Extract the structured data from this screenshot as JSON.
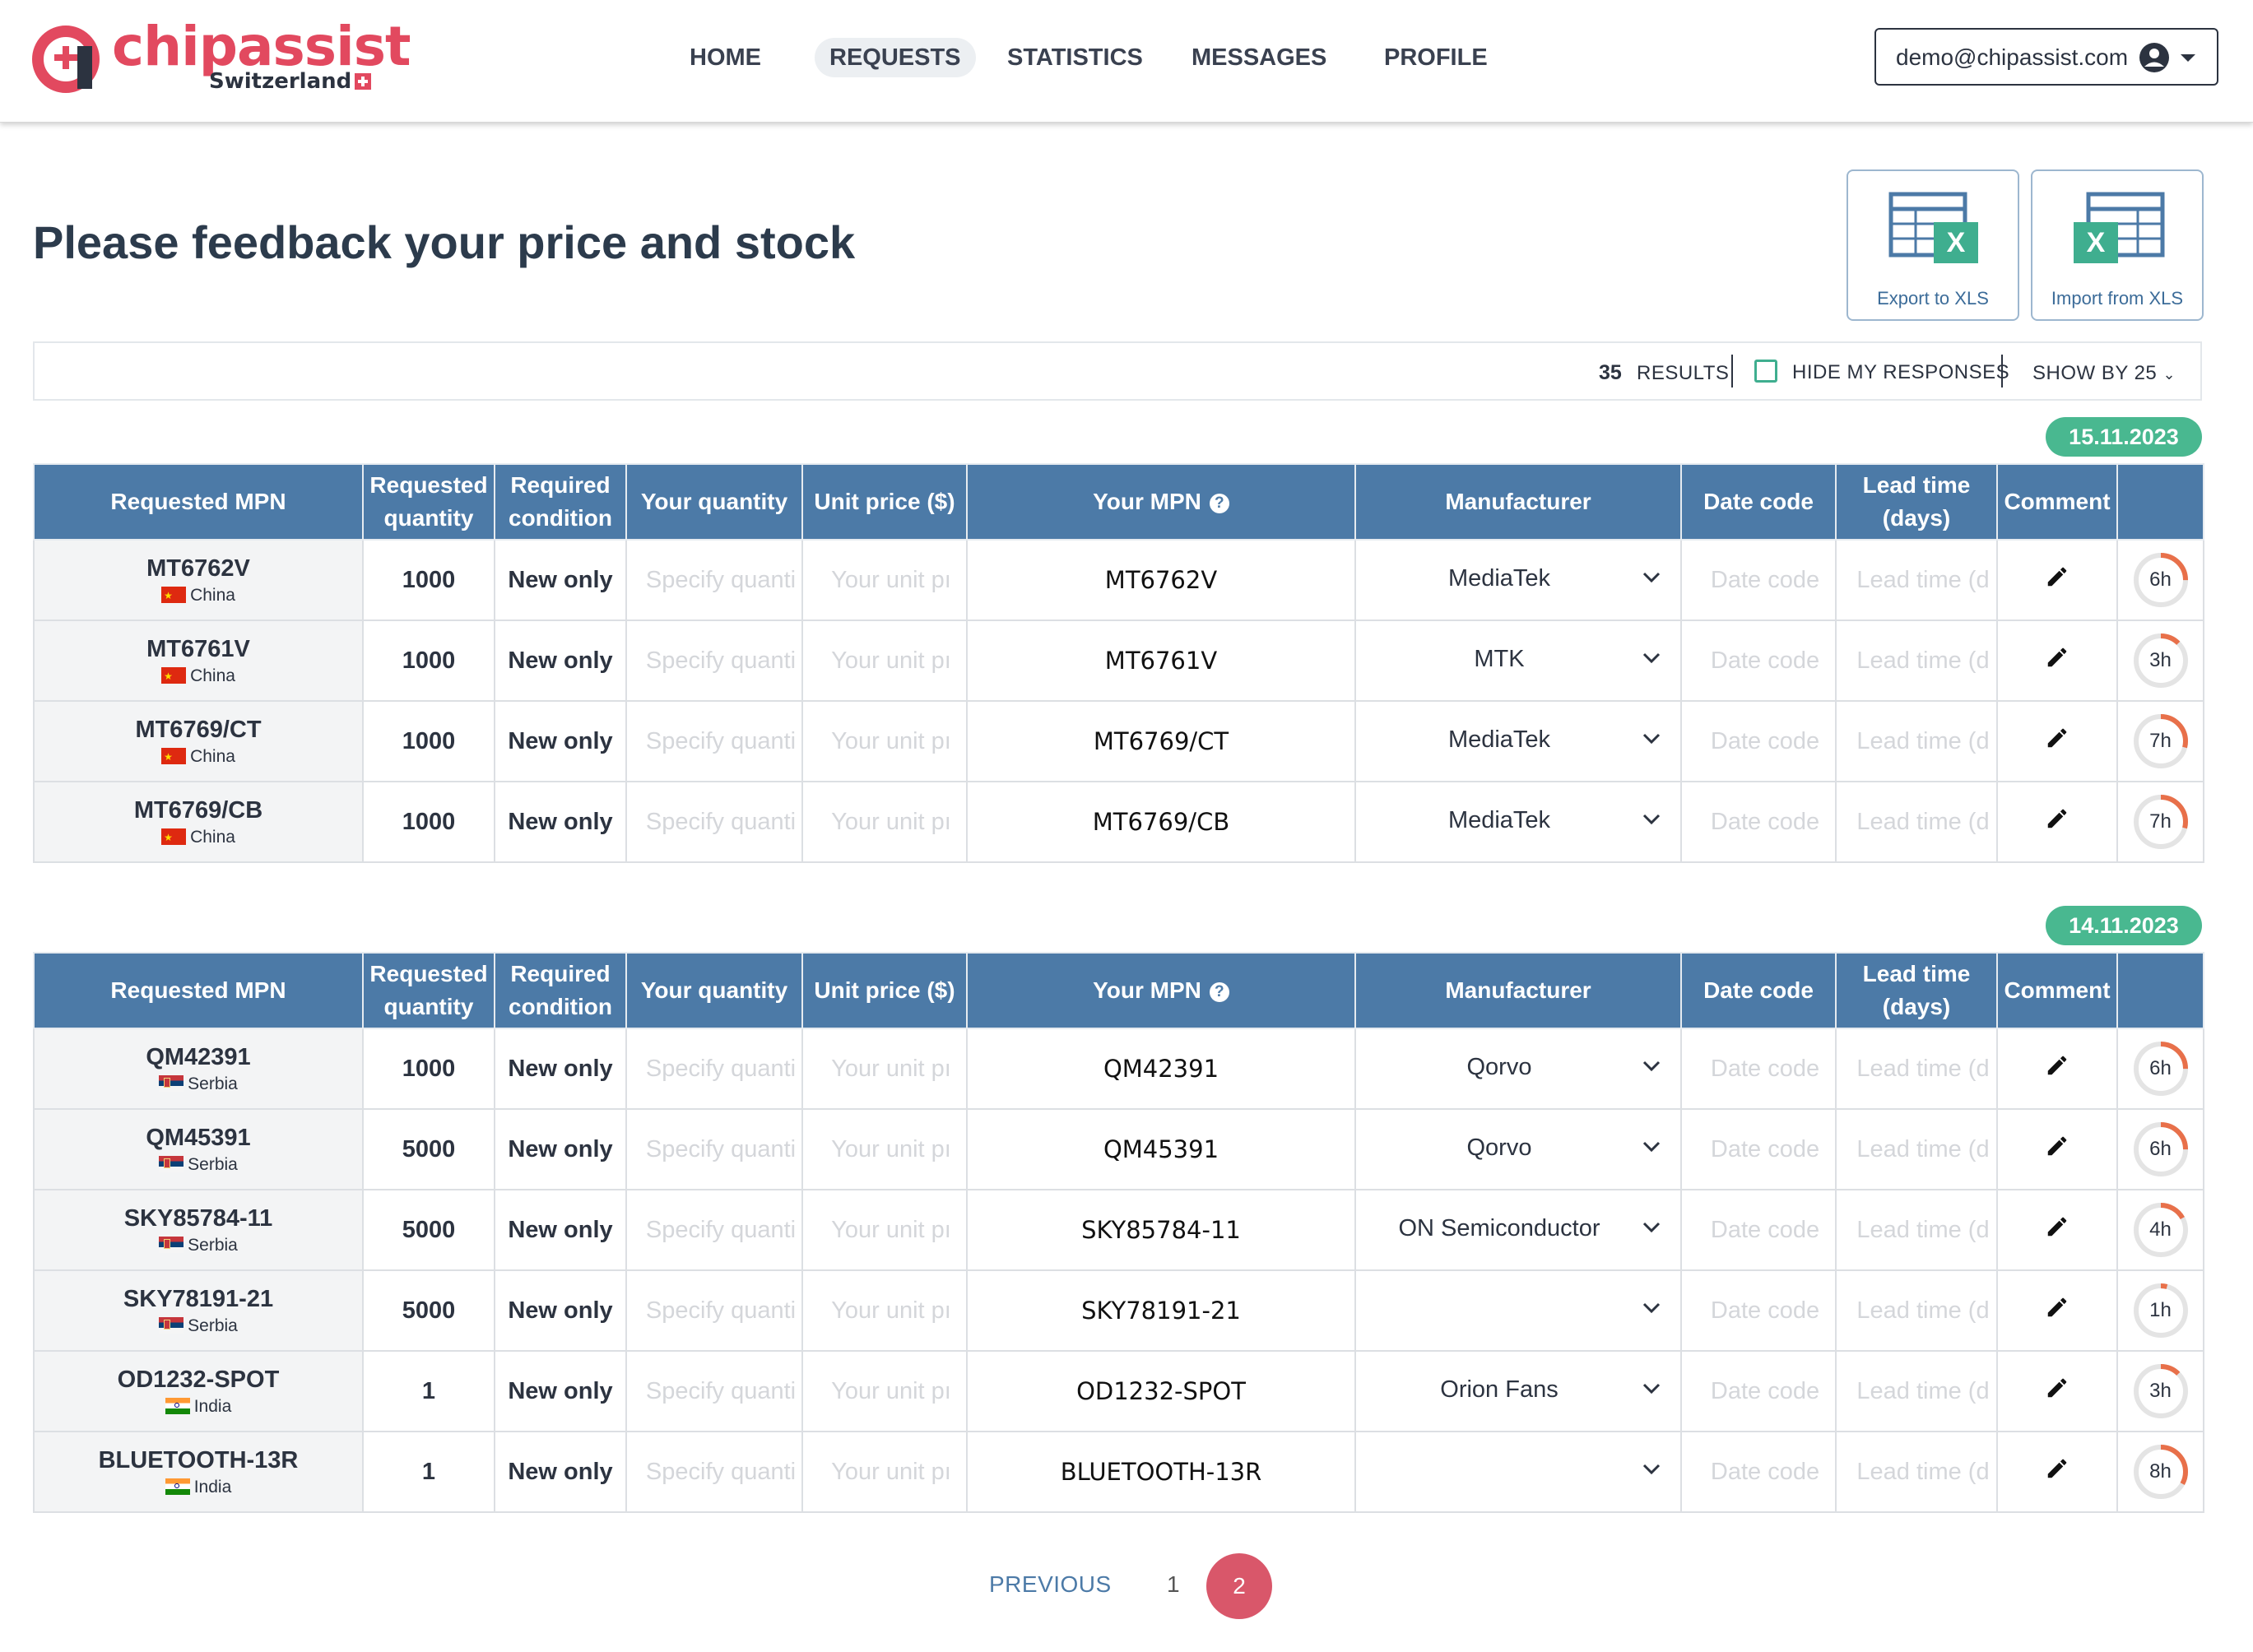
{
  "brand": {
    "name": "chipassist",
    "sub": "Switzerland"
  },
  "nav": {
    "home": "HOME",
    "requests": "REQUESTS",
    "statistics": "STATISTICS",
    "messages": "MESSAGES",
    "profile": "PROFILE"
  },
  "user": {
    "email": "demo@chipassist.com"
  },
  "page_title": "Please feedback your price and stock",
  "xls": {
    "export_label": "Export to XLS",
    "import_label": "Import from XLS"
  },
  "toolbar": {
    "count": "35",
    "results_label": "RESULTS",
    "hide_label": "HIDE MY RESPONSES",
    "show_by": "SHOW BY 25"
  },
  "table_headers": {
    "requested_mpn": "Requested MPN",
    "requested_qty_1": "Requested",
    "requested_qty_2": "quantity",
    "required_cond_1": "Required",
    "required_cond_2": "condition",
    "your_qty": "Your quantity",
    "unit_price": "Unit price ($)",
    "your_mpn": "Your MPN",
    "manufacturer": "Manufacturer",
    "date_code": "Date code",
    "lead_time_1": "Lead time",
    "lead_time_2": "(days)",
    "comment": "Comment"
  },
  "placeholders": {
    "qty": "Specify quanti",
    "price": "Your unit pı",
    "date": "Date code",
    "lead": "Lead time (d"
  },
  "groups": [
    {
      "date": "15.11.2023",
      "rows": [
        {
          "mpn": "MT6762V",
          "country": "China",
          "flag": "cn",
          "qty": "1000",
          "cond": "New only",
          "your_mpn": "MT6762V",
          "manufacturer": "MediaTek",
          "time": "6h",
          "progress": 0.25
        },
        {
          "mpn": "MT6761V",
          "country": "China",
          "flag": "cn",
          "qty": "1000",
          "cond": "New only",
          "your_mpn": "MT6761V",
          "manufacturer": "MTK",
          "time": "3h",
          "progress": 0.125
        },
        {
          "mpn": "MT6769/CT",
          "country": "China",
          "flag": "cn",
          "qty": "1000",
          "cond": "New only",
          "your_mpn": "MT6769/CT",
          "manufacturer": "MediaTek",
          "time": "7h",
          "progress": 0.29
        },
        {
          "mpn": "MT6769/CB",
          "country": "China",
          "flag": "cn",
          "qty": "1000",
          "cond": "New only",
          "your_mpn": "MT6769/CB",
          "manufacturer": "MediaTek",
          "time": "7h",
          "progress": 0.29
        }
      ]
    },
    {
      "date": "14.11.2023",
      "rows": [
        {
          "mpn": "QM42391",
          "country": "Serbia",
          "flag": "rs",
          "qty": "1000",
          "cond": "New only",
          "your_mpn": "QM42391",
          "manufacturer": "Qorvo",
          "time": "6h",
          "progress": 0.25
        },
        {
          "mpn": "QM45391",
          "country": "Serbia",
          "flag": "rs",
          "qty": "5000",
          "cond": "New only",
          "your_mpn": "QM45391",
          "manufacturer": "Qorvo",
          "time": "6h",
          "progress": 0.25
        },
        {
          "mpn": "SKY85784-11",
          "country": "Serbia",
          "flag": "rs",
          "qty": "5000",
          "cond": "New only",
          "your_mpn": "SKY85784-11",
          "manufacturer": "ON Semiconductor",
          "time": "4h",
          "progress": 0.17
        },
        {
          "mpn": "SKY78191-21",
          "country": "Serbia",
          "flag": "rs",
          "qty": "5000",
          "cond": "New only",
          "your_mpn": "SKY78191-21",
          "manufacturer": "",
          "time": "1h",
          "progress": 0.04
        },
        {
          "mpn": "OD1232-SPOT",
          "country": "India",
          "flag": "in",
          "qty": "1",
          "cond": "New only",
          "your_mpn": "OD1232-SPOT",
          "manufacturer": "Orion Fans",
          "time": "3h",
          "progress": 0.125
        },
        {
          "mpn": "BLUETOOTH-13R",
          "country": "India",
          "flag": "in",
          "qty": "1",
          "cond": "New only",
          "your_mpn": "BLUETOOTH-13R",
          "manufacturer": "",
          "time": "8h",
          "progress": 0.33
        }
      ]
    }
  ],
  "pagination": {
    "previous": "PREVIOUS",
    "page1": "1",
    "page2": "2"
  },
  "colors": {
    "accent": "#e2495f",
    "header_blue": "#4c7aa7",
    "badge_green": "#49b890",
    "timer_orange": "#e8704a"
  }
}
